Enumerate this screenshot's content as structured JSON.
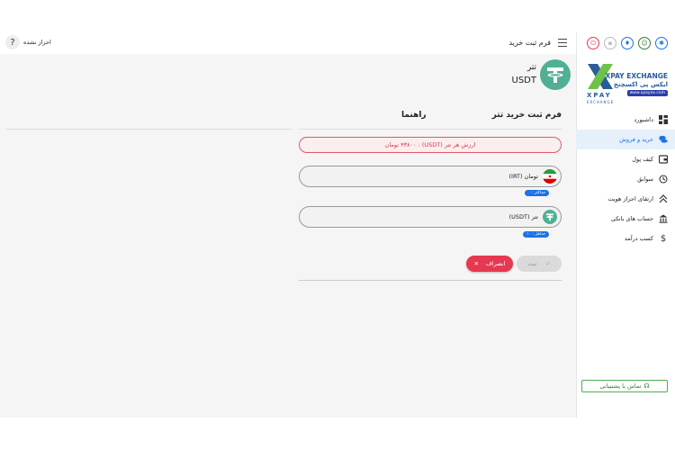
{
  "header": {
    "page_title": "فرم ثبت خرید",
    "auth_status": "احراز نشده",
    "help_symbol": "?"
  },
  "coin": {
    "name": "تتر",
    "symbol": "USDT"
  },
  "form": {
    "title": "فرم ثبت خرید تتر",
    "guide_title": "راهنما",
    "rate_text": "ارزش هر تتر (USDT) : ۴۳۸۰۰ تومان",
    "toman_label": "تومان (IRT)",
    "toman_hint": "حداکثر : ۰",
    "tether_label": "تتر (USDT)",
    "tether_hint": "حداقل : ۱۰",
    "submit_label": "ثبت",
    "cancel_label": "انصراف"
  },
  "brand": {
    "name_en": "XPAY EXCHANGE",
    "name_fa": "ایکس پی اکسچنج",
    "website": "www.xpayex.com",
    "logo_text": "XPAY",
    "logo_sub": "EXCHANGE"
  },
  "sidebar": {
    "items": [
      {
        "label": "داشبورد",
        "icon": "dashboard-icon"
      },
      {
        "label": "خرید و فروش",
        "icon": "coins-icon"
      },
      {
        "label": "کیف پول",
        "icon": "wallet-icon"
      },
      {
        "label": "سوابق",
        "icon": "history-icon"
      },
      {
        "label": "ارتقای احراز هویت",
        "icon": "upgrade-icon"
      },
      {
        "label": "حساب های بانکی",
        "icon": "bank-icon"
      },
      {
        "label": "کسب درآمد",
        "icon": "dollar-icon"
      }
    ],
    "support_label": "تماس با پشتیبانی"
  },
  "colors": {
    "primary": "#1a73e8",
    "danger": "#e53950",
    "tether": "#50af95",
    "success": "#4caf50"
  }
}
